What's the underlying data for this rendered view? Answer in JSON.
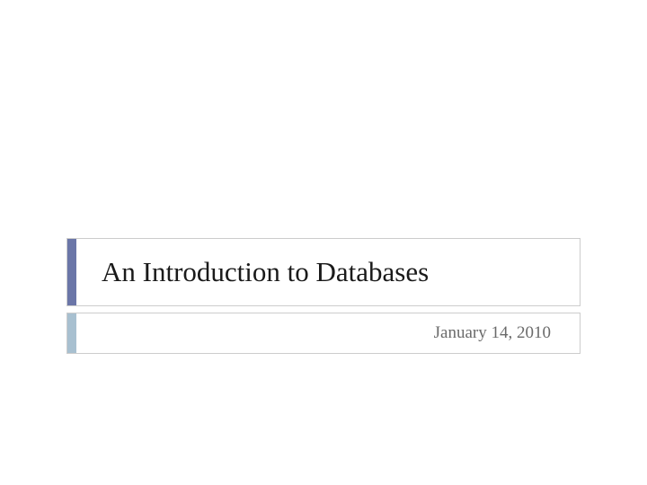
{
  "slide": {
    "title": "An Introduction to Databases",
    "subtitle": "January 14, 2010"
  },
  "colors": {
    "title_accent": "#6b76a8",
    "subtitle_accent": "#a8c0d0",
    "border": "#cccccc"
  }
}
